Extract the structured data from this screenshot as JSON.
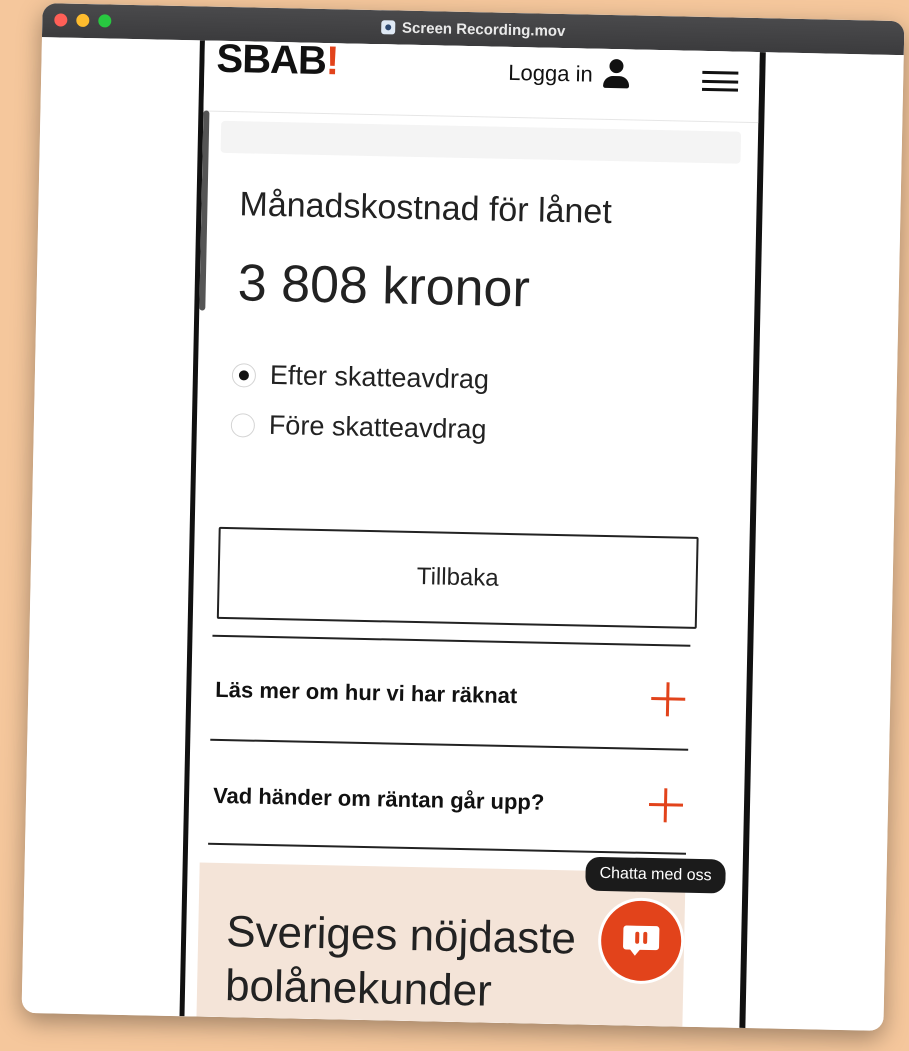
{
  "window": {
    "title": "Screen Recording.mov"
  },
  "header": {
    "logo_text": "SBAB",
    "logo_mark": "!",
    "login_label": "Logga in"
  },
  "loan": {
    "label": "Månadskostnad för lånet",
    "amount": "3 808 kronor"
  },
  "tax_options": [
    {
      "label": "Efter skatteavdrag",
      "selected": true
    },
    {
      "label": "Före skatteavdrag",
      "selected": false
    }
  ],
  "back_button": "Tillbaka",
  "accordions": [
    {
      "label": "Läs mer om hur vi har räknat",
      "icon": "plus-icon"
    },
    {
      "label": "Vad händer om räntan går upp?",
      "icon": "plus-icon"
    }
  ],
  "promo": {
    "heading": "Sveriges nöjdaste bolånekunder"
  },
  "chat": {
    "tooltip": "Chatta med oss",
    "icon": "chat-icon"
  },
  "colors": {
    "accent": "#e2431b",
    "promo_bg": "#f4e4d8",
    "desktop_bg": "#f5c79c"
  }
}
